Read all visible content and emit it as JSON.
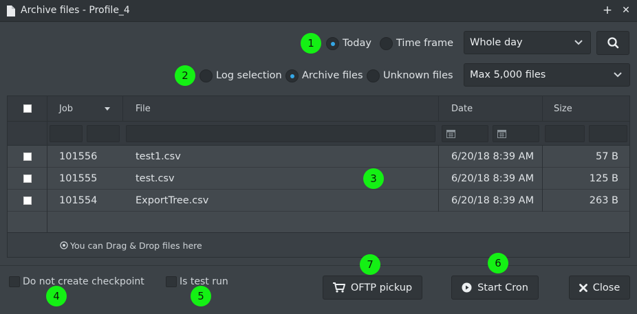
{
  "window": {
    "title": "Archive files - Profile_4",
    "add_glyph": "+",
    "close_glyph": "✕"
  },
  "badges": [
    "1",
    "2",
    "3",
    "4",
    "5",
    "6",
    "7"
  ],
  "filters": {
    "range": {
      "today": "Today",
      "time_frame": "Time frame",
      "selected": "today"
    },
    "day_select": "Whole day",
    "source": {
      "log_selection": "Log selection",
      "archive_files": "Archive files",
      "unknown_files": "Unknown files",
      "selected": "archive_files"
    },
    "max_select": "Max 5,000 files"
  },
  "table": {
    "columns": {
      "job": "Job",
      "file": "File",
      "date": "Date",
      "size": "Size"
    },
    "rows": [
      {
        "job": "101556",
        "file": "test1.csv",
        "date": "6/20/18 8:39 AM",
        "size": "57 B"
      },
      {
        "job": "101555",
        "file": "test.csv",
        "date": "6/20/18 8:39 AM",
        "size": "125 B"
      },
      {
        "job": "101554",
        "file": "ExportTree.csv",
        "date": "6/20/18 8:39 AM",
        "size": "263 B"
      }
    ],
    "drag_hint": "You can Drag & Drop files here"
  },
  "options": {
    "no_checkpoint": "Do not create checkpoint",
    "test_run": "Is test run"
  },
  "buttons": {
    "oftp": "OFTP pickup",
    "start_cron": "Start Cron",
    "close": "Close"
  },
  "colors": {
    "accent": "#35a7e6",
    "badge": "#14f014",
    "background": "#3c4247"
  }
}
